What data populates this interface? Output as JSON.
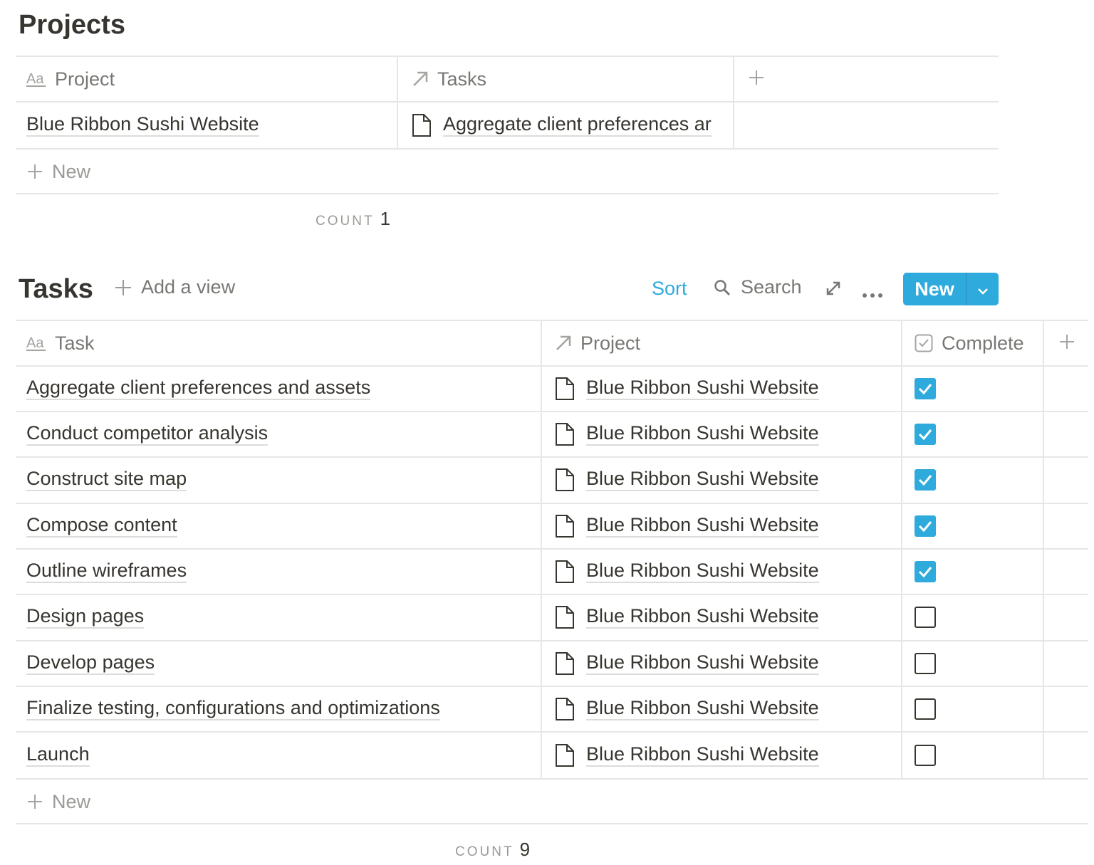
{
  "projects": {
    "title": "Projects",
    "columns": [
      {
        "label": "Project",
        "icon": "title-aa-icon"
      },
      {
        "label": "Tasks",
        "icon": "relation-arrow-icon"
      }
    ],
    "rows": [
      {
        "project": "Blue Ribbon Sushi Website",
        "tasks": "Aggregate client preferences ar"
      }
    ],
    "new_label": "New",
    "count_label": "COUNT",
    "count_value": "1"
  },
  "tasks": {
    "title": "Tasks",
    "add_view_label": "Add a view",
    "toolbar": {
      "sort_label": "Sort",
      "search_label": "Search",
      "new_label": "New",
      "accent_color": "#2eaadc"
    },
    "columns": [
      {
        "label": "Task",
        "icon": "title-aa-icon"
      },
      {
        "label": "Project",
        "icon": "relation-arrow-icon"
      },
      {
        "label": "Complete",
        "icon": "checkbox-icon"
      }
    ],
    "rows": [
      {
        "task": "Aggregate client preferences and assets",
        "project": "Blue Ribbon Sushi Website",
        "complete": true
      },
      {
        "task": "Conduct competitor analysis",
        "project": "Blue Ribbon Sushi Website",
        "complete": true
      },
      {
        "task": "Construct site map",
        "project": "Blue Ribbon Sushi Website",
        "complete": true
      },
      {
        "task": "Compose content",
        "project": "Blue Ribbon Sushi Website",
        "complete": true
      },
      {
        "task": "Outline wireframes",
        "project": "Blue Ribbon Sushi Website",
        "complete": true
      },
      {
        "task": "Design pages",
        "project": "Blue Ribbon Sushi Website",
        "complete": false
      },
      {
        "task": "Develop pages",
        "project": "Blue Ribbon Sushi Website",
        "complete": false
      },
      {
        "task": "Finalize testing, configurations and optimizations",
        "project": "Blue Ribbon Sushi Website",
        "complete": false
      },
      {
        "task": "Launch",
        "project": "Blue Ribbon Sushi Website",
        "complete": false
      }
    ],
    "new_label": "New",
    "count_label": "COUNT",
    "count_value": "9"
  }
}
